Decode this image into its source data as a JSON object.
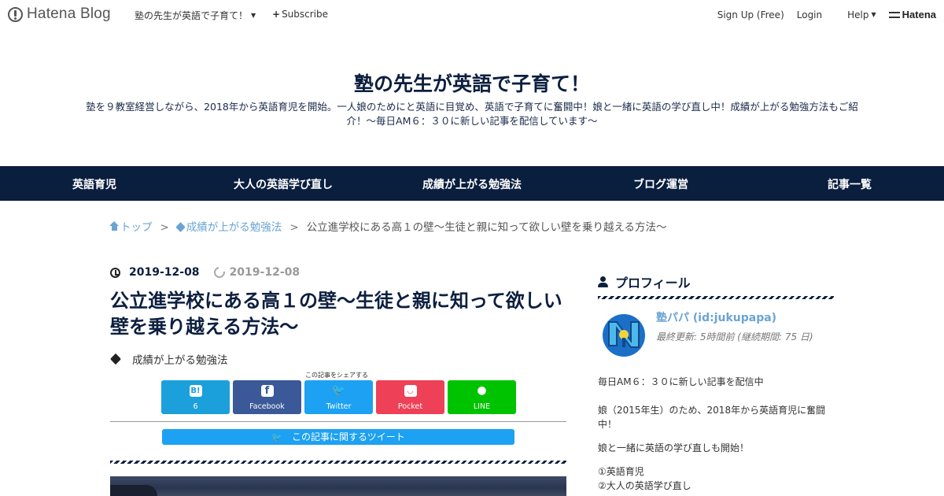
{
  "topbar": {
    "logo_text": "Hatena Blog",
    "blog_menu_label": "塾の先生が英語で子育て！",
    "subscribe_label": "Subscribe",
    "signup_label": "Sign Up (Free)",
    "login_label": "Login",
    "help_label": "Help",
    "brand_label": "Hatena"
  },
  "header": {
    "title": "塾の先生が英語で子育て！",
    "description": "塾を９教室経営しながら、2018年から英語育児を開始。一人娘のためにと英語に目覚め、英語で子育てに奮闘中！娘と一緒に英語の学び直し中！成績が上がる勉強方法もご紹介！～毎日AM６：３０に新しい記事を配信しています～"
  },
  "nav": {
    "items": [
      "英語育児",
      "大人の英語学び直し",
      "成績が上がる勉強法",
      "ブログ運営",
      "記事一覧"
    ]
  },
  "breadcrumb": {
    "home": "トップ",
    "separator": ">",
    "category": "成績が上がる勉強法",
    "current": "公立進学校にある高１の壁～生徒と親に知って欲しい壁を乗り越える方法～"
  },
  "article": {
    "published": "2019-12-08",
    "updated": "2019-12-08",
    "title": "公立進学校にある高１の壁～生徒と親に知って欲しい壁を乗り越える方法～",
    "category": "成績が上がる勉強法"
  },
  "share": {
    "caption": "この記事をシェアする",
    "buttons": [
      {
        "label": "6",
        "symbol": "B!",
        "color": "#1ba0db",
        "icon": "hatena-bookmark-icon"
      },
      {
        "label": "Facebook",
        "symbol": "f",
        "color": "#3b5998",
        "icon": "facebook-icon"
      },
      {
        "label": "Twitter",
        "symbol": "🐦",
        "color": "#1da1f2",
        "icon": "twitter-icon"
      },
      {
        "label": "Pocket",
        "symbol": "◡",
        "color": "#ee4056",
        "icon": "pocket-icon"
      },
      {
        "label": "LINE",
        "symbol": "●",
        "color": "#00c300",
        "icon": "line-icon"
      }
    ],
    "tweet_label": "この記事に関するツイート"
  },
  "sidebar": {
    "heading": "プロフィール",
    "name": "塾パパ (id:jukupapa)",
    "updated": "最終更新: 5時間前 (継続期間: 75 日)",
    "lines": [
      "毎日AM６：３０に新しい記事を配信中",
      "娘（2015年生）のため、2018年から英語育児に奮闘中！",
      "娘と一緒に英語の学び直しも開始！",
      "①英語育児",
      "②大人の英語学び直し"
    ]
  }
}
